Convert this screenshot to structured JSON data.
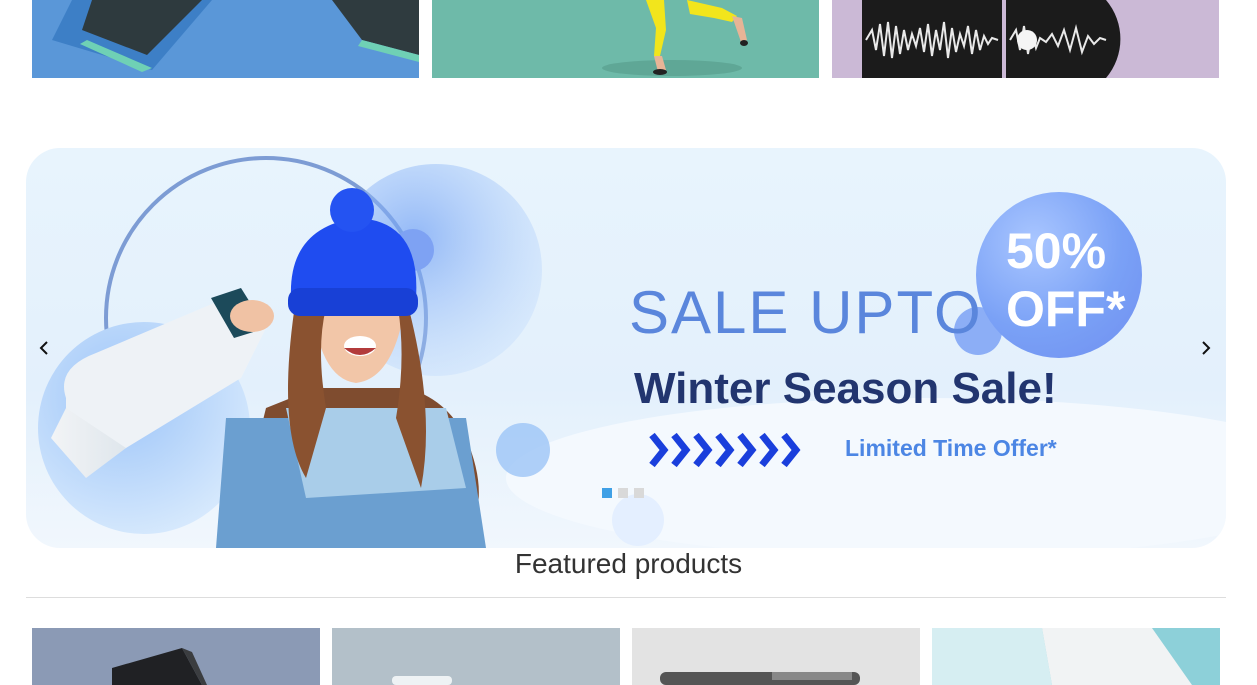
{
  "category_tiles": [
    {
      "name": "category-tile-1",
      "icon": "book-stack-image"
    },
    {
      "name": "category-tile-2",
      "icon": "dancer-image"
    },
    {
      "name": "category-tile-3",
      "icon": "vinyl-record-image"
    }
  ],
  "banner": {
    "sale_upto": "SALE UPTO",
    "badge_line1": "50%",
    "badge_line2": "OFF*",
    "headline": "Winter Season Sale!",
    "offer": "Limited Time Offer*",
    "prev_icon": "chevron-left-icon",
    "next_icon": "chevron-right-icon",
    "slides": 3,
    "active_slide": 1,
    "colors": {
      "accent": "#5a86dc",
      "headline": "#22356f",
      "offer": "#4c86e4",
      "dot_active": "#3fa0e6"
    }
  },
  "featured": {
    "title": "Featured products"
  }
}
